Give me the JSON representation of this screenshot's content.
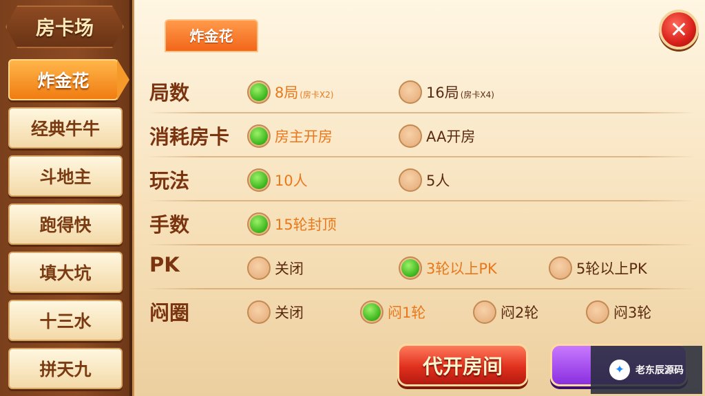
{
  "sidebar": {
    "title": "房卡场",
    "items": [
      {
        "label": "炸金花"
      },
      {
        "label": "经典牛牛"
      },
      {
        "label": "斗地主"
      },
      {
        "label": "跑得快"
      },
      {
        "label": "填大坑"
      },
      {
        "label": "十三水"
      },
      {
        "label": "拼天九"
      }
    ]
  },
  "panel": {
    "tab_label": "炸金花",
    "close_icon": "✕",
    "rows": [
      {
        "label": "局数",
        "options": [
          {
            "text": "8局",
            "sub": "(房卡X2)",
            "selected": true
          },
          {
            "text": "16局",
            "sub": "(房卡X4)",
            "selected": false
          }
        ]
      },
      {
        "label": "消耗房卡",
        "options": [
          {
            "text": "房主开房",
            "selected": true
          },
          {
            "text": "AA开房",
            "selected": false
          }
        ]
      },
      {
        "label": "玩法",
        "options": [
          {
            "text": "10人",
            "selected": true
          },
          {
            "text": "5人",
            "selected": false
          }
        ]
      },
      {
        "label": "手数",
        "options": [
          {
            "text": "15轮封顶",
            "selected": true
          }
        ]
      },
      {
        "label": "PK",
        "options": [
          {
            "text": "关闭",
            "selected": false
          },
          {
            "text": "3轮以上PK",
            "selected": true
          },
          {
            "text": "5轮以上PK",
            "selected": false
          }
        ]
      },
      {
        "label": "闷圈",
        "options": [
          {
            "text": "关闭",
            "selected": false
          },
          {
            "text": "闷1轮",
            "selected": true
          },
          {
            "text": "闷2轮",
            "selected": false
          },
          {
            "text": "闷3轮",
            "selected": false
          }
        ]
      }
    ],
    "proxy_button": "代开房间"
  },
  "watermark": {
    "text": "老东辰源码",
    "icon": "✦"
  },
  "colors": {
    "accent_orange": "#f07c12",
    "selected_green": "#3fb81e",
    "text_brown": "#7a3410",
    "button_red": "#e0301e",
    "button_purple": "#8a2ee0"
  }
}
